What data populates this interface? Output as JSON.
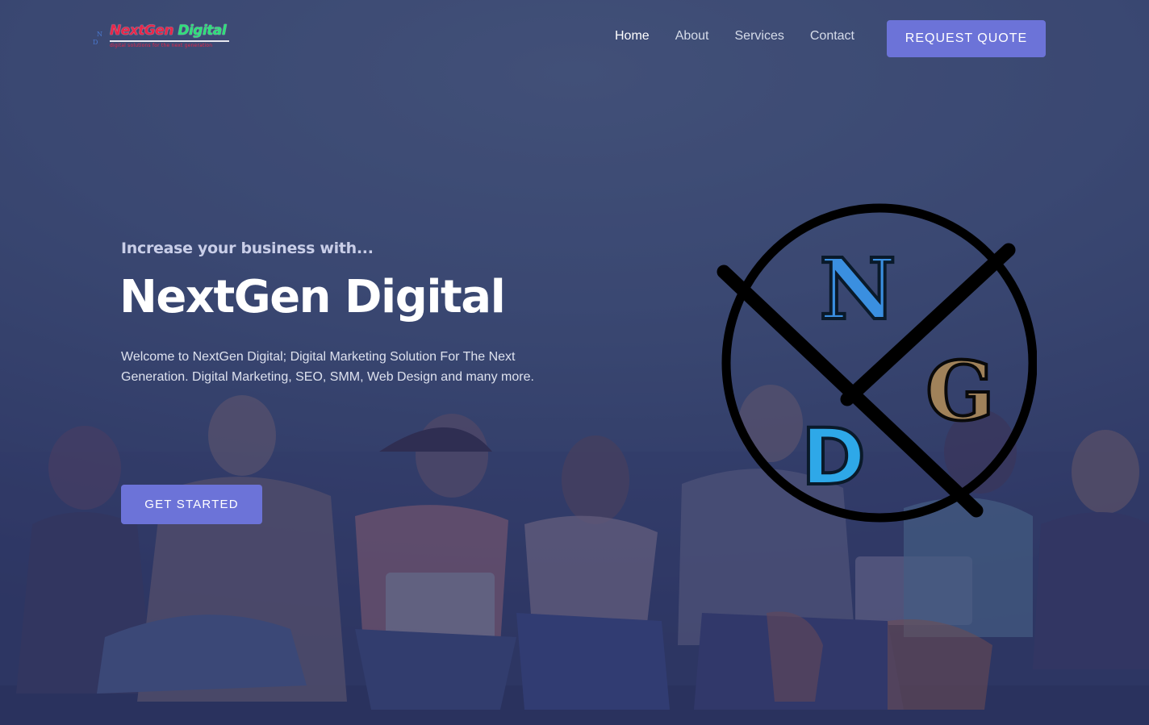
{
  "header": {
    "logo": {
      "mark_letters": [
        "N",
        "D"
      ],
      "name_part1": "NextGen",
      "name_part2": "Digital",
      "tagline": "digital solutions for the next generation"
    },
    "nav": [
      "Home",
      "About",
      "Services",
      "Contact"
    ],
    "active_nav": "Home",
    "cta_label": "REQUEST QUOTE"
  },
  "hero": {
    "eyebrow": "Increase your business with...",
    "title": "NextGen Digital",
    "description": "Welcome to NextGen Digital; Digital Marketing Solution For The Next Generation. Digital Marketing, SEO, SMM, Web Design and many more.",
    "button_label": "GET STARTED",
    "emblem_letters": {
      "top": "N",
      "left": "D",
      "right": "G"
    }
  },
  "colors": {
    "accent": "#6c73d8",
    "background": "#3a4a6e",
    "emblem_n": "#3a8fe0",
    "emblem_d": "#2ea8e8",
    "emblem_g": "#a0825a"
  }
}
